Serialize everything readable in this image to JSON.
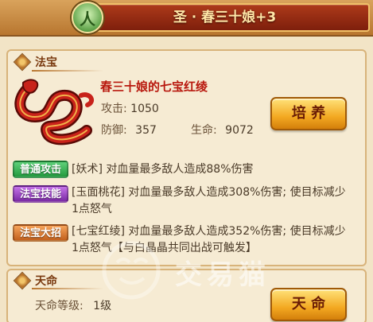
{
  "header": {
    "emblem_char": "人",
    "title": "圣 · 春三十娘+3"
  },
  "treasure_section": {
    "title": "法宝",
    "item_name": "春三十娘的七宝红绫",
    "attack_label": "攻击:",
    "attack_value": "1050",
    "defense_label": "防御:",
    "defense_value": "357",
    "hp_label": "生命:",
    "hp_value": "9072",
    "cultivate_button": "培 养"
  },
  "skills": [
    {
      "tag": "普通攻击",
      "text": "[妖术] 对血量最多敌人造成88%伤害"
    },
    {
      "tag": "法宝技能",
      "text": "[玉面桃花] 对血量最多敌人造成308%伤害; 使目标减少1点怒气"
    },
    {
      "tag": "法宝大招",
      "text": "[七宝红绫] 对血量最多敌人造成352%伤害; 使目标减少1点怒气【与白晶晶共同出战可触发】"
    }
  ],
  "destiny_section": {
    "title": "天命",
    "level_label": "天命等级:",
    "level_value": "1级",
    "destiny_button": "天 命"
  },
  "watermark": "交易猫",
  "colors": {
    "header_bar": "#8e2810",
    "item_name": "#b8180e",
    "button": "#f3a922",
    "tag_normal": "#2fa84a",
    "tag_skill": "#8e3ab8",
    "tag_ult": "#d06a22"
  }
}
